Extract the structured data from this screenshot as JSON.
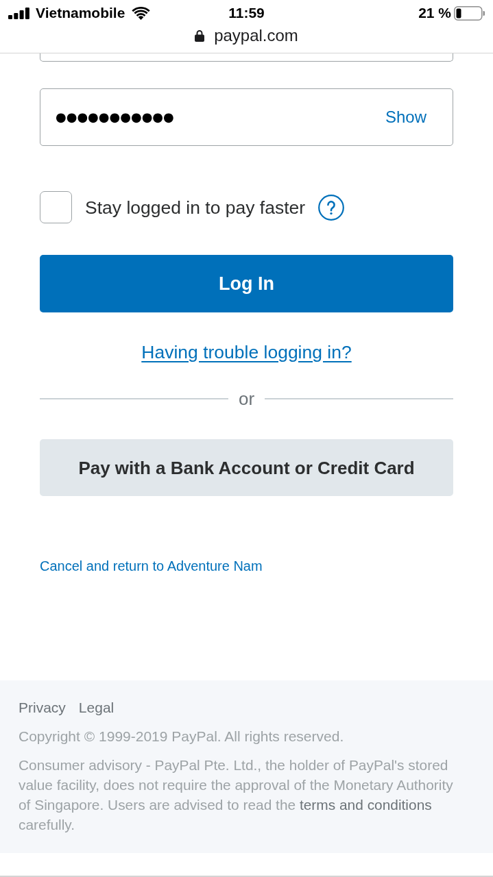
{
  "status_bar": {
    "carrier": "Vietnamobile",
    "time": "11:59",
    "battery": "21 %"
  },
  "address_bar": {
    "url": "paypal.com"
  },
  "form": {
    "password": {
      "value": "●●●●●●●●●●●",
      "toggle": "Show"
    },
    "stay_logged_in": {
      "label": "Stay logged in to pay faster",
      "checked": false
    },
    "login_button": "Log In",
    "trouble_link": "Having trouble logging in?",
    "divider": "or",
    "guest_button": "Pay with a Bank Account or Credit Card",
    "cancel_link": "Cancel and return to Adventure Nam"
  },
  "footer": {
    "links": [
      "Privacy",
      "Legal"
    ],
    "copyright": "Copyright © 1999-2019 PayPal. All rights reserved.",
    "advisory": {
      "before": "Consumer advisory - PayPal Pte. Ltd., the holder of PayPal's stored value facility, does not require the approval of the Monetary Authority of Singapore. Users are advised to read the",
      "link": "terms and conditions",
      "after": "carefully."
    }
  }
}
